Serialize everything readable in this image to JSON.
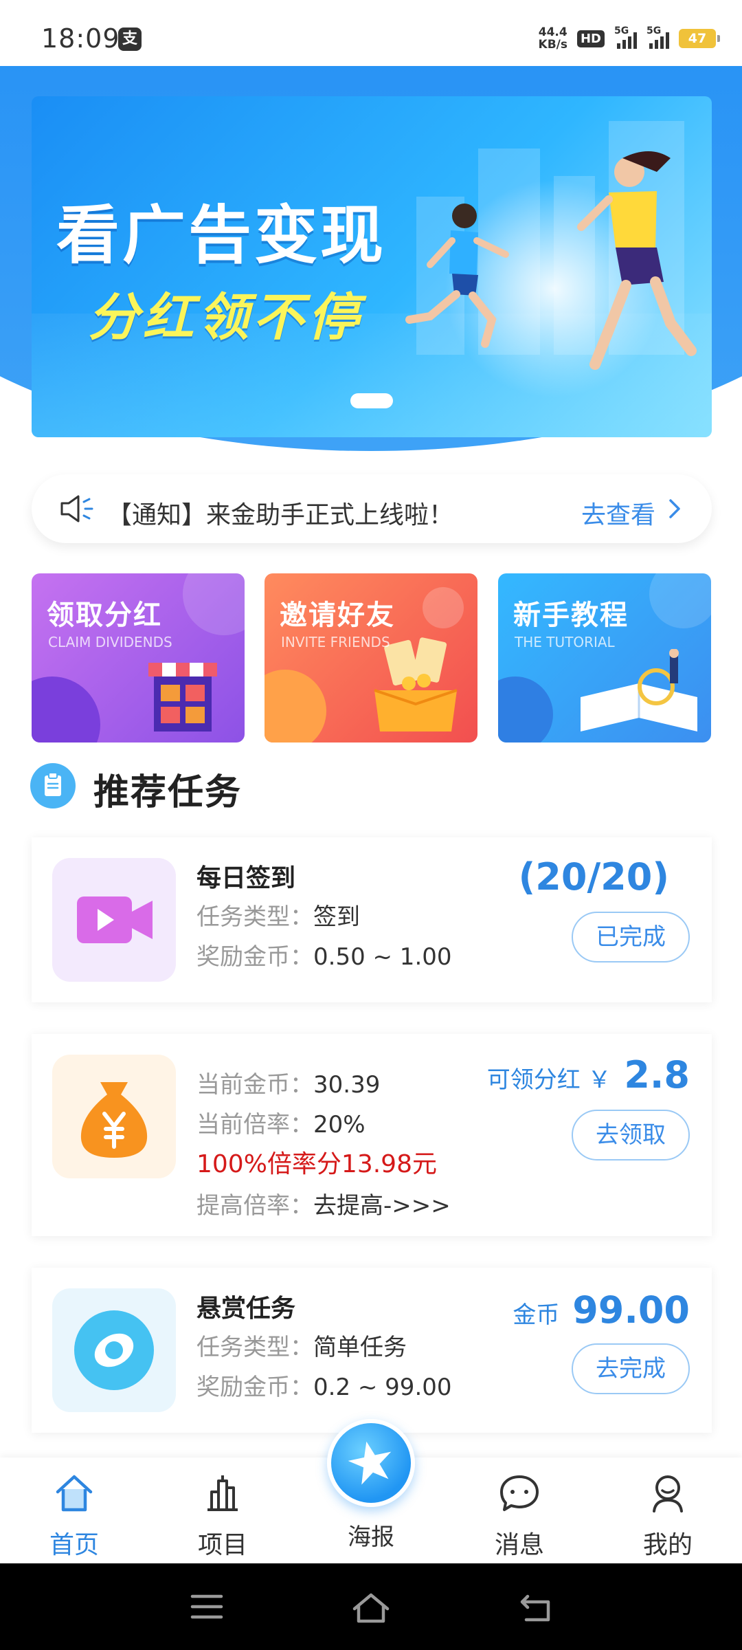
{
  "status_bar": {
    "time": "18:09",
    "pay_icon": "支",
    "net_speed_value": "44.4",
    "net_speed_unit": "KB/s",
    "hd": "HD",
    "signal_1": "5G",
    "signal_2": "5G",
    "battery": "47"
  },
  "banner": {
    "title": "看广告变现",
    "subtitle": "分红领不停"
  },
  "notice": {
    "text": "【通知】来金助手正式上线啦！",
    "link": "去查看"
  },
  "feature_cards": [
    {
      "title": "领取分红",
      "subtitle": "CLAIM DIVIDENDS"
    },
    {
      "title": "邀请好友",
      "subtitle": "INVITE FRIENDS"
    },
    {
      "title": "新手教程",
      "subtitle": "THE TUTORIAL"
    }
  ],
  "section": {
    "title": "推荐任务"
  },
  "tasks": {
    "signin": {
      "name": "每日签到",
      "type_label": "任务类型：",
      "type_value": "签到",
      "reward_label": "奖励金币：",
      "reward_value": "0.50 ~ 1.00",
      "progress": "(20/20)",
      "button": "已完成"
    },
    "dividend": {
      "coins_label": "当前金币：",
      "coins_value": "30.39",
      "rate_label": "当前倍率：",
      "rate_value": "20%",
      "full_rate_text": "100%倍率分13.98元",
      "boost_label": "提高倍率：",
      "boost_value": "去提高->>>",
      "claimable_label": "可领分红 ￥",
      "claimable_value": "2.8",
      "button": "去领取"
    },
    "bounty": {
      "name": "悬赏任务",
      "type_label": "任务类型：",
      "type_value": "简单任务",
      "reward_label": "奖励金币：",
      "reward_value": "0.2 ~ 99.00",
      "coin_label": "金币",
      "coin_value": "99.00",
      "button": "去完成"
    }
  },
  "bottom_nav": {
    "home": "首页",
    "projects": "项目",
    "poster": "海报",
    "messages": "消息",
    "mine": "我的"
  },
  "colors": {
    "accent": "#2e86e0",
    "hero_blue": "#1e8cf4",
    "warning_red": "#d51919"
  }
}
